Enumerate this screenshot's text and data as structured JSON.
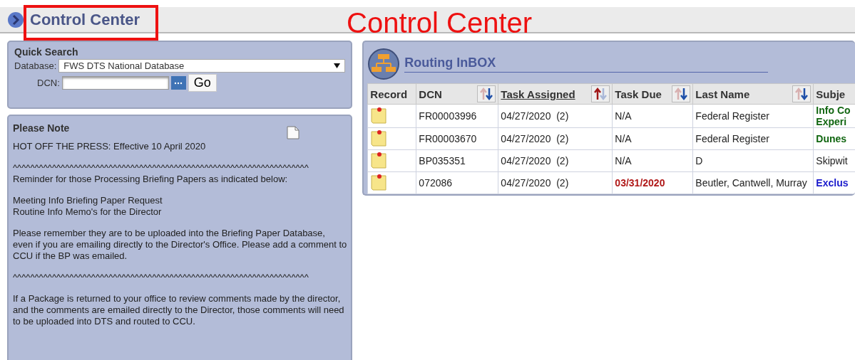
{
  "header": {
    "title": "Control Center"
  },
  "annotation": {
    "label": "Control Center"
  },
  "quick_search": {
    "title": "Quick Search",
    "database_label": "Database:",
    "database_value": "FWS DTS National Database",
    "dcn_label": "DCN:",
    "go_button": "Go"
  },
  "note": {
    "title": "Please Note",
    "paragraphs": [
      "HOT OFF THE PRESS: Effective 10 April 2020",
      "^^^^^^^^^^^^^^^^^^^^^^^^^^^^^^^^^^^^^^^^^^^^^^^^^^^^^^^^^^^^^^^^^^^^\nReminder for those Processing Briefing Papers as indicated below:",
      "Meeting Info Briefing Paper Request\nRoutine Info Memo's for the Director\n ",
      "Please remember they are to be uploaded into the Briefing Paper Database, even if you are emailing directly to the Director's Office. Please add a comment to CCU if the BP was emailed.",
      "^^^^^^^^^^^^^^^^^^^^^^^^^^^^^^^^^^^^^^^^^^^^^^^^^^^^^^^^^^^^^^^^^^^^",
      "If a Package is returned to your office to review comments made by the director, and the comments are emailed directly to the Director, those comments will need to be uploaded into DTS and routed to CCU."
    ]
  },
  "inbox": {
    "title": "Routing InBOX",
    "columns": [
      {
        "label": "Record",
        "sortable": false,
        "sorted": false
      },
      {
        "label": "DCN",
        "sortable": true,
        "sorted": false
      },
      {
        "label": "Task Assigned",
        "sortable": true,
        "sorted": true
      },
      {
        "label": "Task Due",
        "sortable": true,
        "sorted": false
      },
      {
        "label": "Last Name",
        "sortable": true,
        "sorted": false
      },
      {
        "label": "Subje",
        "sorted": false
      }
    ],
    "rows": [
      {
        "dcn": "FR00003996",
        "task_assigned": "04/27/2020  (2)",
        "task_due": "N/A",
        "overdue": false,
        "last_name": "Federal Register",
        "subject": {
          "text": "Info Co\nExperi",
          "bold": true,
          "color": "#116611"
        }
      },
      {
        "dcn": "FR00003670",
        "task_assigned": "04/27/2020  (2)",
        "task_due": "N/A",
        "overdue": false,
        "last_name": "Federal Register",
        "subject": {
          "text": "Dunes",
          "bold": true,
          "color": "#116611"
        }
      },
      {
        "dcn": "BP035351",
        "task_assigned": "04/27/2020  (2)",
        "task_due": "N/A",
        "overdue": false,
        "last_name": "D",
        "subject": {
          "text": "Skipwit",
          "bold": false,
          "color": "#222222"
        }
      },
      {
        "dcn": "072086",
        "task_assigned": "04/27/2020  (2)",
        "task_due": "03/31/2020",
        "overdue": true,
        "last_name": "Beutler, Cantwell, Murray",
        "subject": {
          "text": "Exclus",
          "bold": true,
          "color": "#1a1acc"
        }
      }
    ]
  }
}
